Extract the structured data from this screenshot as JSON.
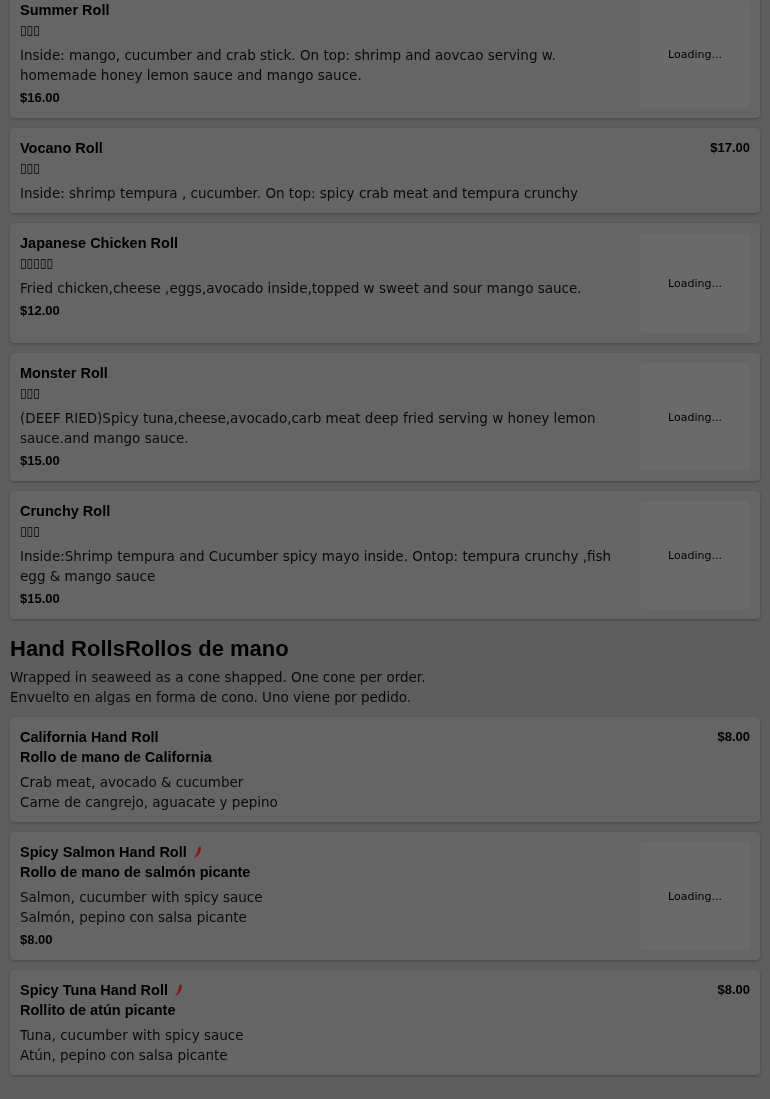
{
  "sections": [
    {
      "items": [
        {
          "kind": "with-image",
          "names": [
            "Summer Roll"
          ],
          "spicy": false,
          "native_name": "▯▯▯",
          "description": [
            "Inside: mango, cucumber and crab stick. On top: shrimp and aovcao serving w. homemade honey lemon sauce and mango sauce."
          ],
          "price": "$16.00",
          "image_status": "Loading..."
        },
        {
          "kind": "no-image",
          "names": [
            "Vocano Roll"
          ],
          "spicy": false,
          "native_name": "▯▯▯",
          "description": [
            "Inside: shrimp tempura , cucumber. On top: spicy crab meat and tempura crunchy"
          ],
          "price": "$17.00"
        },
        {
          "kind": "with-image",
          "names": [
            "Japanese Chicken Roll"
          ],
          "spicy": false,
          "native_name": "▯▯▯▯▯",
          "description": [
            "Fried chicken,cheese ,eggs,avocado inside,topped w sweet and sour mango sauce."
          ],
          "price": "$12.00",
          "image_status": "Loading..."
        },
        {
          "kind": "with-image",
          "names": [
            "Monster Roll"
          ],
          "spicy": false,
          "native_name": "▯▯▯",
          "description": [
            "(DEEF RIED)Spicy tuna,cheese,avocado,carb meat deep fried serving w honey lemon sauce.and mango sauce."
          ],
          "price": "$15.00",
          "image_status": "Loading..."
        },
        {
          "kind": "with-image",
          "names": [
            "Crunchy Roll"
          ],
          "spicy": false,
          "native_name": "▯▯▯",
          "description": [
            "Inside:Shrimp tempura and Cucumber spicy mayo inside. Ontop: tempura crunchy ,fish egg & mango sauce"
          ],
          "price": "$15.00",
          "image_status": "Loading..."
        }
      ]
    },
    {
      "title": "Hand RollsRollos de mano",
      "intro": [
        "Wrapped in seaweed as a cone shapped. One cone per order.",
        "Envuelto en algas en forma de cono. Uno viene por pedido."
      ],
      "items": [
        {
          "kind": "no-image",
          "names": [
            "California Hand Roll",
            "Rollo de mano de California"
          ],
          "spicy": false,
          "description": [
            "Crab meat, avocado & cucumber",
            "Carne de cangrejo, aguacate y pepino"
          ],
          "price": "$8.00"
        },
        {
          "kind": "with-image",
          "names": [
            "Spicy Salmon Hand Roll",
            "Rollo de mano de salmón picante"
          ],
          "spicy": true,
          "description": [
            "Salmon, cucumber with spicy sauce",
            "Salmón, pepino con salsa picante"
          ],
          "price": "$8.00",
          "image_status": "Loading..."
        },
        {
          "kind": "no-image",
          "names": [
            "Spicy Tuna Hand Roll",
            "Rollito de atún picante"
          ],
          "spicy": true,
          "description": [
            "Tuna, cucumber with spicy sauce",
            "Atún, pepino con salsa picante"
          ],
          "price": "$8.00"
        }
      ]
    }
  ]
}
